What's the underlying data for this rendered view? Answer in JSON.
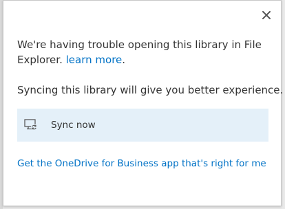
{
  "dialog": {
    "close_icon": "close-icon",
    "message_text": "We're having trouble opening this library in File Explorer.",
    "learn_more_label": "learn more",
    "message_suffix": ".",
    "sub_message": "Syncing this library will give you better experience.",
    "sync_button": {
      "icon": "monitor-sync-icon",
      "label": "Sync now"
    },
    "app_link_label": "Get the OneDrive for Business app that's right for me"
  },
  "colors": {
    "link": "#0072c6",
    "button_background": "#e4f0f9",
    "text": "#333333"
  }
}
